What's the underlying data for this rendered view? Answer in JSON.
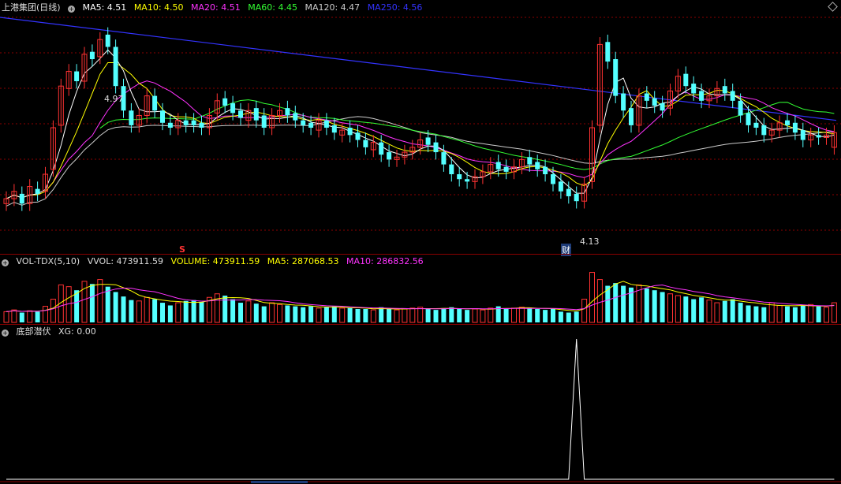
{
  "price_panel": {
    "title": "上港集团(日线)",
    "ma": [
      {
        "label": "MA5: 4.51",
        "color": "#ffffff"
      },
      {
        "label": "MA10: 4.50",
        "color": "#ffff00"
      },
      {
        "label": "MA20: 4.51",
        "color": "#ff33ff"
      },
      {
        "label": "MA60: 4.45",
        "color": "#33ff33"
      },
      {
        "label": "MA120: 4.47",
        "color": "#cccccc"
      },
      {
        "label": "MA250: 4.56",
        "color": "#3333ff"
      }
    ],
    "high_label": "4.97",
    "low_label": "4.13",
    "marker_s": "S",
    "marker_cai": "财"
  },
  "volume_panel": {
    "name": "VOL-TDX(5,10)",
    "vol": "VVOL: 473911.59",
    "volume": "VOLUME: 473911.59",
    "ma5": "MA5: 287068.53",
    "ma10": "MA10: 286832.56"
  },
  "indicator_panel": {
    "name": "底部潜伏",
    "xg": "XG: 0.00"
  },
  "colors": {
    "up": "#ff3232",
    "down": "#54ffff",
    "grid": "#8b0000",
    "ma250": "#3333ff"
  },
  "chart_data": {
    "type": "candlestick",
    "closes": [
      4.26,
      4.29,
      4.24,
      4.31,
      4.28,
      4.36,
      4.55,
      4.72,
      4.78,
      4.74,
      4.85,
      4.83,
      4.91,
      4.88,
      4.72,
      4.62,
      4.56,
      4.6,
      4.68,
      4.62,
      4.57,
      4.55,
      4.58,
      4.56,
      4.56,
      4.55,
      4.6,
      4.66,
      4.64,
      4.61,
      4.59,
      4.62,
      4.58,
      4.55,
      4.6,
      4.62,
      4.6,
      4.58,
      4.56,
      4.55,
      4.58,
      4.55,
      4.53,
      4.54,
      4.52,
      4.5,
      4.47,
      4.49,
      4.44,
      4.42,
      4.43,
      4.45,
      4.47,
      4.5,
      4.48,
      4.45,
      4.4,
      4.36,
      4.34,
      4.33,
      4.35,
      4.37,
      4.4,
      4.38,
      4.37,
      4.39,
      4.42,
      4.4,
      4.38,
      4.36,
      4.32,
      4.29,
      4.27,
      4.25,
      4.32,
      4.55,
      4.89,
      4.82,
      4.68,
      4.62,
      4.56,
      4.68,
      4.66,
      4.64,
      4.62,
      4.7,
      4.76,
      4.72,
      4.69,
      4.66,
      4.68,
      4.71,
      4.69,
      4.66,
      4.6,
      4.56,
      4.55,
      4.52,
      4.54,
      4.57,
      4.56,
      4.53,
      4.5,
      4.52,
      4.51,
      4.52,
      4.53
    ],
    "opens": [
      4.24,
      4.26,
      4.28,
      4.24,
      4.3,
      4.29,
      4.38,
      4.56,
      4.71,
      4.78,
      4.74,
      4.86,
      4.84,
      4.93,
      4.88,
      4.72,
      4.62,
      4.56,
      4.6,
      4.68,
      4.62,
      4.57,
      4.55,
      4.58,
      4.58,
      4.57,
      4.55,
      4.61,
      4.67,
      4.65,
      4.62,
      4.58,
      4.63,
      4.6,
      4.55,
      4.6,
      4.63,
      4.61,
      4.58,
      4.57,
      4.54,
      4.58,
      4.56,
      4.52,
      4.55,
      4.53,
      4.5,
      4.46,
      4.49,
      4.45,
      4.42,
      4.43,
      4.45,
      4.47,
      4.51,
      4.49,
      4.45,
      4.4,
      4.36,
      4.34,
      4.33,
      4.35,
      4.37,
      4.41,
      4.39,
      4.37,
      4.39,
      4.43,
      4.41,
      4.39,
      4.36,
      4.33,
      4.3,
      4.28,
      4.25,
      4.33,
      4.56,
      4.9,
      4.83,
      4.69,
      4.63,
      4.56,
      4.69,
      4.67,
      4.65,
      4.63,
      4.7,
      4.77,
      4.73,
      4.7,
      4.66,
      4.68,
      4.72,
      4.7,
      4.66,
      4.61,
      4.57,
      4.56,
      4.52,
      4.54,
      4.58,
      4.57,
      4.54,
      4.5,
      4.52,
      4.51,
      4.47
    ],
    "low_value": 4.13,
    "high_value": 4.97,
    "volumes": [
      60,
      70,
      55,
      65,
      60,
      90,
      130,
      210,
      200,
      180,
      230,
      215,
      240,
      200,
      170,
      145,
      125,
      120,
      140,
      130,
      110,
      95,
      110,
      120,
      125,
      115,
      140,
      160,
      150,
      130,
      110,
      120,
      105,
      90,
      110,
      100,
      95,
      90,
      85,
      90,
      80,
      85,
      90,
      80,
      80,
      75,
      75,
      70,
      85,
      75,
      70,
      75,
      80,
      85,
      75,
      70,
      80,
      85,
      75,
      70,
      75,
      70,
      80,
      90,
      75,
      80,
      85,
      80,
      75,
      70,
      75,
      60,
      55,
      60,
      130,
      280,
      240,
      205,
      220,
      205,
      195,
      210,
      190,
      180,
      170,
      160,
      150,
      145,
      130,
      140,
      125,
      110,
      120,
      130,
      110,
      95,
      90,
      85,
      110,
      95,
      90,
      85,
      95,
      100,
      90,
      85,
      110
    ],
    "volume_ma5": [],
    "volume_ma10": [],
    "xg_signals": [
      0,
      0,
      0,
      0,
      0,
      0,
      0,
      0,
      0,
      0,
      0,
      0,
      0,
      0,
      0,
      0,
      0,
      0,
      0,
      0,
      0,
      0,
      0,
      0,
      0,
      0,
      0,
      0,
      0,
      0,
      0,
      0,
      0,
      0,
      0,
      0,
      0,
      0,
      0,
      0,
      0,
      0,
      0,
      0,
      0,
      0,
      0,
      0,
      0,
      0,
      0,
      0,
      0,
      0,
      0,
      0,
      0,
      0,
      0,
      0,
      0,
      0,
      0,
      0,
      0,
      0,
      0,
      0,
      0,
      0,
      0,
      0,
      0,
      1,
      0,
      0,
      0,
      0,
      0,
      0,
      0,
      0,
      0,
      0,
      0,
      0,
      0,
      0,
      0,
      0,
      0,
      0,
      0,
      0,
      0,
      0,
      0,
      0,
      0,
      0,
      0,
      0,
      0,
      0,
      0,
      0,
      0
    ],
    "ma250": [
      4.9,
      4.895,
      4.89,
      4.885,
      4.88,
      4.875,
      4.87,
      4.865,
      4.86,
      4.855
    ]
  }
}
